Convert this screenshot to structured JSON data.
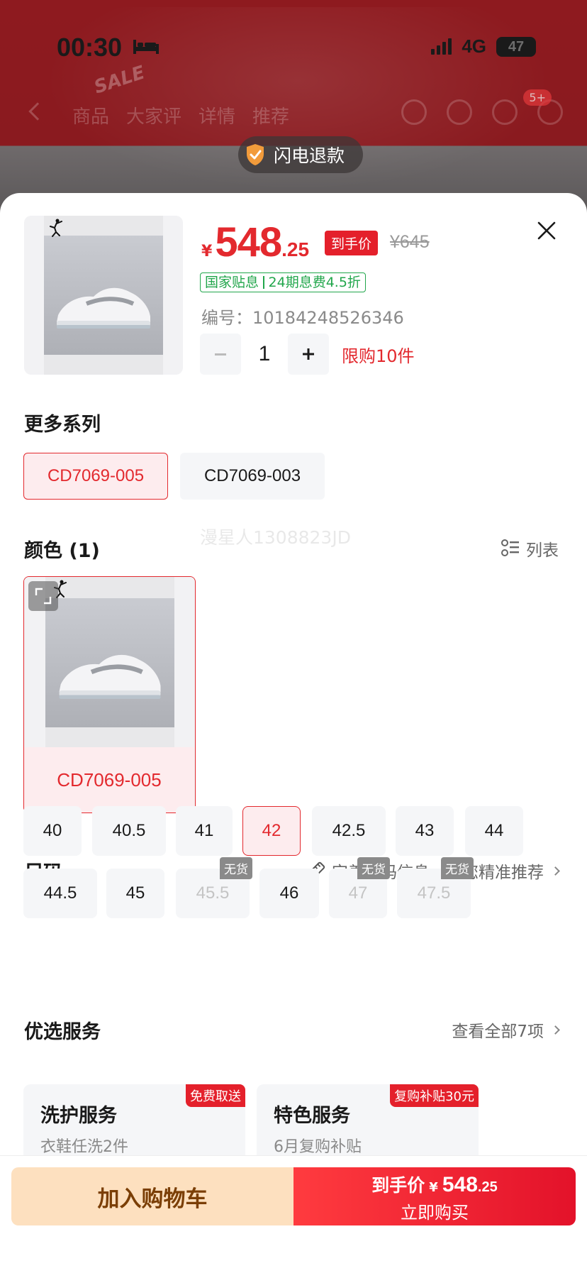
{
  "status_bar": {
    "time": "00:30",
    "network": "4G",
    "battery": "47"
  },
  "backdrop": {
    "sale_mark": "SALE",
    "tabs": [
      "商品",
      "大家评",
      "详情",
      "推荐"
    ],
    "badge": "5+",
    "refund_text": "闪电退款"
  },
  "product": {
    "currency": "¥",
    "price_int": "548",
    "price_dec": ".25",
    "price_tag": "到手价",
    "original_price": "¥645",
    "subsidy": [
      "国家贴息",
      "24期息费4.5折"
    ],
    "sku_label": "编号：",
    "sku": "10184248526346",
    "quantity": "1",
    "limit": "限购10件"
  },
  "series": {
    "title": "更多系列",
    "options": [
      "CD7069-005",
      "CD7069-003"
    ],
    "selected": "CD7069-005"
  },
  "color": {
    "title": "颜色 (1)",
    "list_label": "列表",
    "option": "CD7069-005",
    "watermark": "漫星人1308823JD"
  },
  "size": {
    "title": "尺码",
    "hint": "完善尺码信息，为您精准推荐",
    "options": [
      {
        "label": "40",
        "status": "available"
      },
      {
        "label": "40.5",
        "status": "available"
      },
      {
        "label": "41",
        "status": "available"
      },
      {
        "label": "42",
        "status": "selected"
      },
      {
        "label": "42.5",
        "status": "available"
      },
      {
        "label": "43",
        "status": "available"
      },
      {
        "label": "44",
        "status": "available"
      },
      {
        "label": "44.5",
        "status": "available"
      },
      {
        "label": "45",
        "status": "available"
      },
      {
        "label": "45.5",
        "status": "out_of_stock"
      },
      {
        "label": "46",
        "status": "available"
      },
      {
        "label": "47",
        "status": "out_of_stock"
      },
      {
        "label": "47.5",
        "status": "out_of_stock"
      }
    ],
    "oos_label": "无货"
  },
  "services": {
    "title": "优选服务",
    "view_all": "查看全部7项",
    "cards": [
      {
        "title": "洗护服务",
        "subtitle": "衣鞋任洗2件",
        "tag": "免费取送"
      },
      {
        "title": "特色服务",
        "subtitle": "6月复购补贴",
        "tag": "复购补贴30元"
      }
    ]
  },
  "actions": {
    "add_to_cart": "加入购物车",
    "buy_label": "到手价",
    "buy_currency": "¥",
    "buy_int": "548",
    "buy_dec": ".25",
    "buy_now": "立即购买"
  },
  "colors": {
    "accent": "#e3292e",
    "subsidy_green": "#21a64b",
    "cart_bg": "#fde0bf"
  }
}
